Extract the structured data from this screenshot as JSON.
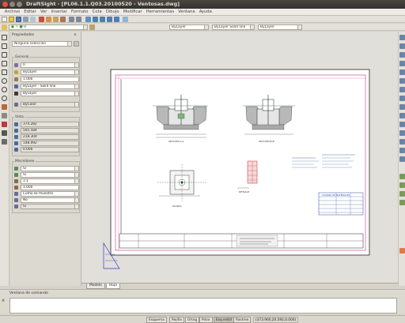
{
  "window": {
    "title": "DraftSight - [PL06.1.1.Q03.20100520 - Ventosas.dwg]"
  },
  "menu": [
    "Archivo",
    "Editar",
    "Ver",
    "Insertar",
    "Formato",
    "Cota",
    "Dibujo",
    "Modificar",
    "Herramientas",
    "Ventana",
    "Ayuda"
  ],
  "layers_toolbar": {
    "layer_value": "0",
    "color_value": "ByLayer",
    "linetype_value": "ByLayer",
    "lineweight_value": "ByLayer",
    "linestyle_value": "Solid line"
  },
  "properties": {
    "title": "Propiedades",
    "selection": "Ninguna selección",
    "general_header": "General",
    "general": [
      "0",
      "ByLayer",
      "1.000",
      "ByLayer - Solid line",
      "ByLayer",
      "ByColor"
    ],
    "view_header": "Vista",
    "view": [
      "374.282",
      "505.584",
      "218.304",
      "148.092",
      "0.000"
    ],
    "misc_header": "Misceláneo",
    "misc": [
      "Sí",
      "Sí",
      "1:1",
      "1.000",
      "Como se muestra",
      "No",
      "Sí"
    ]
  },
  "layout_tabs": [
    "Modelo",
    "Hoja"
  ],
  "command": {
    "header": "Ventana de comando"
  },
  "status": {
    "buttons": [
      "Esquema",
      "Rejilla",
      "Ortog",
      "Polar",
      "Esq entid",
      "Rastreo"
    ],
    "coords": "(373.960,20.592,0.000)"
  },
  "drawing": {
    "labels": [
      "SECCIÓN A-A",
      "SECCIÓN B-B",
      "PLANTA",
      "DETALLE",
      "CUADRO DE MATERIALES"
    ]
  },
  "colors": {
    "accent": "#e8a0a0",
    "paper": "#ffffff",
    "frame": "#c23a8a",
    "titlebar": "#3c3a35"
  }
}
